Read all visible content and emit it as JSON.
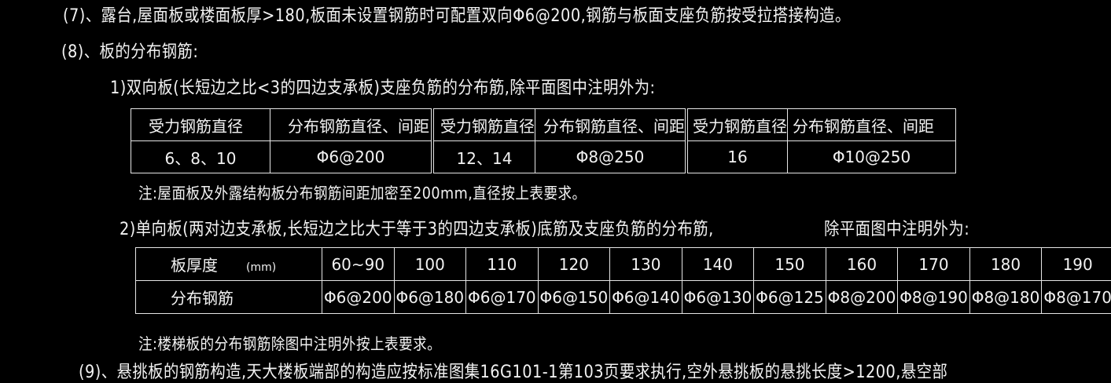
{
  "lines": {
    "item7": "(7)、露台,屋面板或楼面板厚>180,板面未设置钢筋时可配置双向Φ6@200,钢筋与板面支座负筋按受拉搭接构造。",
    "item8": "(8)、板的分布钢筋:",
    "sub1": "1)双向板(长短边之比<3的四边支承板)支座负筋的分布筋,除平面图中注明外为:",
    "note1": "注:屋面板及外露结构板分布钢筋间距加密至200mm,直径按上表要求。",
    "sub2": "2)单向板(两对边支承板,长短边之比大于等于3的四边支承板)底筋及支座负筋的分布筋,",
    "sub2_tail": "除平面图中注明外为:",
    "note2": "注:楼梯板的分布钢筋除图中注明外按上表要求。",
    "item9_partial": "(9)、悬挑板的钢筋构造,天大楼板端部的构造应按标准图集16G101-1第103页要求执行,空外悬挑板的悬挑长度>1200,悬空部"
  },
  "table1": {
    "headers": [
      "受力钢筋直径",
      "分布钢筋直径、间距",
      "受力钢筋直径",
      "分布钢筋直径、间距",
      "受力钢筋直径",
      "分布钢筋直径、间距"
    ],
    "values": [
      "6、8、10",
      "Φ6@200",
      "12、14",
      "Φ8@250",
      "16",
      "Φ10@250"
    ]
  },
  "table2": {
    "row1_label": "板厚度",
    "unit": "(mm)",
    "thicknesses": [
      "60~90",
      "100",
      "110",
      "120",
      "130",
      "140",
      "150",
      "160",
      "170",
      "180",
      "190"
    ],
    "row2_label": "分布钢筋",
    "bars": [
      "Φ6@200",
      "Φ6@180",
      "Φ6@170",
      "Φ6@150",
      "Φ6@140",
      "Φ6@130",
      "Φ6@125",
      "Φ8@200",
      "Φ8@190",
      "Φ8@180",
      "Φ8@170"
    ]
  }
}
